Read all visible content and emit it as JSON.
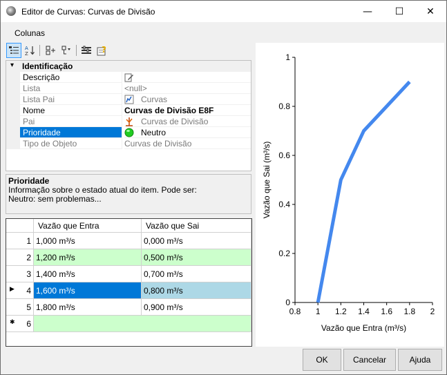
{
  "window": {
    "title": "Editor de Curvas: Curvas de Divisão",
    "minimize_glyph": "—",
    "maximize_glyph": "☐",
    "close_glyph": "✕"
  },
  "menu": {
    "columns_label": "Colunas"
  },
  "toolbar": {
    "icons": [
      "categorized-icon",
      "sort-alphabetical-icon",
      "expand-icon",
      "collapse-icon",
      "properties-icon",
      "help-icon"
    ],
    "sort_glyph": "A↓Z"
  },
  "property_grid": {
    "category": "Identificação",
    "category_toggle": "▾",
    "rows": [
      {
        "name": "Descrição",
        "value": "",
        "icon": "edit-icon"
      },
      {
        "name": "Lista",
        "value": "<null>"
      },
      {
        "name": "Lista Pai",
        "value": "Curvas",
        "icon": "curves-list-icon"
      },
      {
        "name": "Nome",
        "value": "Curvas de Divisão E8F"
      },
      {
        "name": "Pai",
        "value": "Curvas de Divisão",
        "icon": "division-curve-icon"
      },
      {
        "name": "Prioridade",
        "value": "Neutro",
        "icon": "status-green-icon"
      },
      {
        "name": "Tipo de Objeto",
        "value": "Curvas de Divisão"
      }
    ]
  },
  "description": {
    "title": "Prioridade",
    "line1": "Informação sobre o estado atual do item. Pode ser:",
    "line2": "Neutro: sem problemas..."
  },
  "grid": {
    "columns": [
      "Vazão que Entra",
      "Vazão que Sai"
    ],
    "rows": [
      {
        "num": "1",
        "in": "1,000 m³/s",
        "out": "0,000 m³/s"
      },
      {
        "num": "2",
        "in": "1,200 m³/s",
        "out": "0,500 m³/s"
      },
      {
        "num": "3",
        "in": "1,400 m³/s",
        "out": "0,700 m³/s"
      },
      {
        "num": "4",
        "in": "1,600 m³/s",
        "out": "0,800 m³/s"
      },
      {
        "num": "5",
        "in": "1,800 m³/s",
        "out": "0,900 m³/s"
      },
      {
        "num": "6",
        "in": "",
        "out": ""
      }
    ],
    "current_row_marker": "▶",
    "new_row_marker": "✱"
  },
  "chart_data": {
    "type": "line",
    "x": [
      1.0,
      1.2,
      1.4,
      1.6,
      1.8
    ],
    "values": [
      0.0,
      0.5,
      0.7,
      0.8,
      0.9
    ],
    "xlabel": "Vazão que Entra (m³/s)",
    "ylabel": "Vazão que Sai (m³/s)",
    "xlim": [
      0.8,
      2
    ],
    "ylim": [
      0,
      1
    ],
    "x_ticks": [
      "0.8",
      "1",
      "1.2",
      "1.4",
      "1.6",
      "1.8",
      "2"
    ],
    "y_ticks": [
      "0",
      "0.2",
      "0.4",
      "0.6",
      "0.8",
      "1"
    ],
    "line_color": "#4488ee",
    "grid": false
  },
  "buttons": {
    "ok": "OK",
    "cancel": "Cancelar",
    "help": "Ajuda"
  }
}
